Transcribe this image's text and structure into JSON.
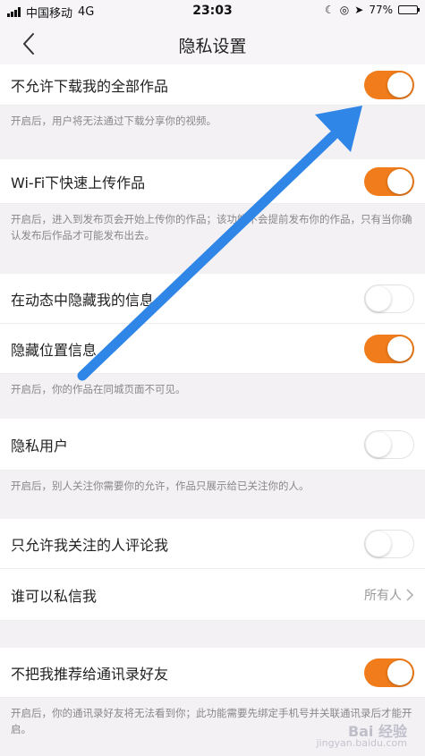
{
  "status_bar": {
    "carrier": "中国移动",
    "network": "4G",
    "time": "23:03",
    "battery": "77%",
    "battery_level": 0.77
  },
  "nav": {
    "title": "隐私设置"
  },
  "settings": [
    {
      "label": "不允许下载我的全部作品",
      "toggle": true,
      "note": "开启后，用户将无法通过下载分享你的视频。"
    },
    {
      "label": "Wi-Fi下快速上传作品",
      "toggle": true,
      "note": "开启后，进入到发布页会开始上传你的作品；该功能不会提前发布你的作品，只有当你确认发布后作品才可能发布出去。"
    },
    {
      "label": "在动态中隐藏我的信息",
      "toggle": false
    },
    {
      "label": "隐藏位置信息",
      "toggle": true,
      "note": "开启后，你的作品在同城页面不可见。"
    },
    {
      "label": "隐私用户",
      "toggle": false,
      "note": "开启后，别人关注你需要你的允许，作品只展示给已关注你的人。"
    },
    {
      "label": "只允许我关注的人评论我",
      "toggle": false
    },
    {
      "label": "谁可以私信我",
      "value": "所有人"
    },
    {
      "label": "不把我推荐给通讯录好友",
      "toggle": true,
      "note": "开启后，你的通讯录好友将无法看到你；此功能需要先绑定手机号并关联通讯录后才能开启。"
    }
  ],
  "watermark": {
    "main": "Bai 经验",
    "sub": "jingyan.baidu.com"
  },
  "colors": {
    "accent": "#f07c1b",
    "arrow": "#2f86e6"
  }
}
